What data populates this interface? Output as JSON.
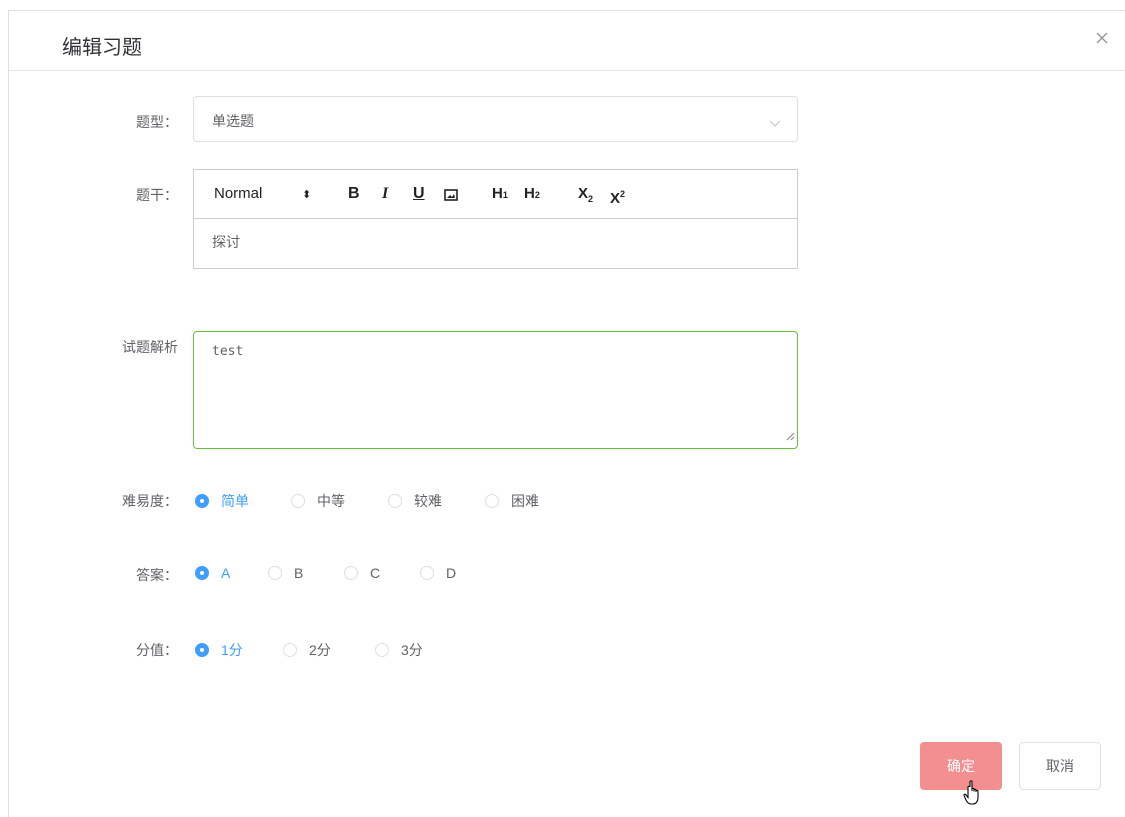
{
  "dialog": {
    "title": "编辑习题",
    "close_icon": "close-icon"
  },
  "form": {
    "type": {
      "label": "题型：",
      "value": "单选题",
      "icon": "chevron-down-icon"
    },
    "stem": {
      "label": "题干：",
      "toolbar": {
        "format": "Normal",
        "format_arrows": "⬍",
        "bold": "B",
        "italic": "I",
        "underline": "U",
        "image_icon": "image-icon",
        "h1": "H",
        "h1_sub": "1",
        "h2": "H",
        "h2_sub": "2",
        "subscript": "X",
        "subscript_sub": "2",
        "superscript": "X",
        "superscript_sup": "2"
      },
      "content": "探讨"
    },
    "analysis": {
      "label": "试题解析",
      "value": "test"
    },
    "difficulty": {
      "label": "难易度：",
      "options": [
        "简单",
        "中等",
        "较难",
        "困难"
      ],
      "selected": "简单"
    },
    "answer": {
      "label": "答案：",
      "options": [
        "A",
        "B",
        "C",
        "D"
      ],
      "selected": "A"
    },
    "score": {
      "label": "分值：",
      "options": [
        "1分",
        "2分",
        "3分"
      ],
      "selected": "1分"
    }
  },
  "footer": {
    "confirm_label": "确定",
    "cancel_label": "取消"
  },
  "colors": {
    "primary": "#409eff",
    "confirm_bg": "#f38f8f",
    "valid_border": "#67c23a"
  }
}
